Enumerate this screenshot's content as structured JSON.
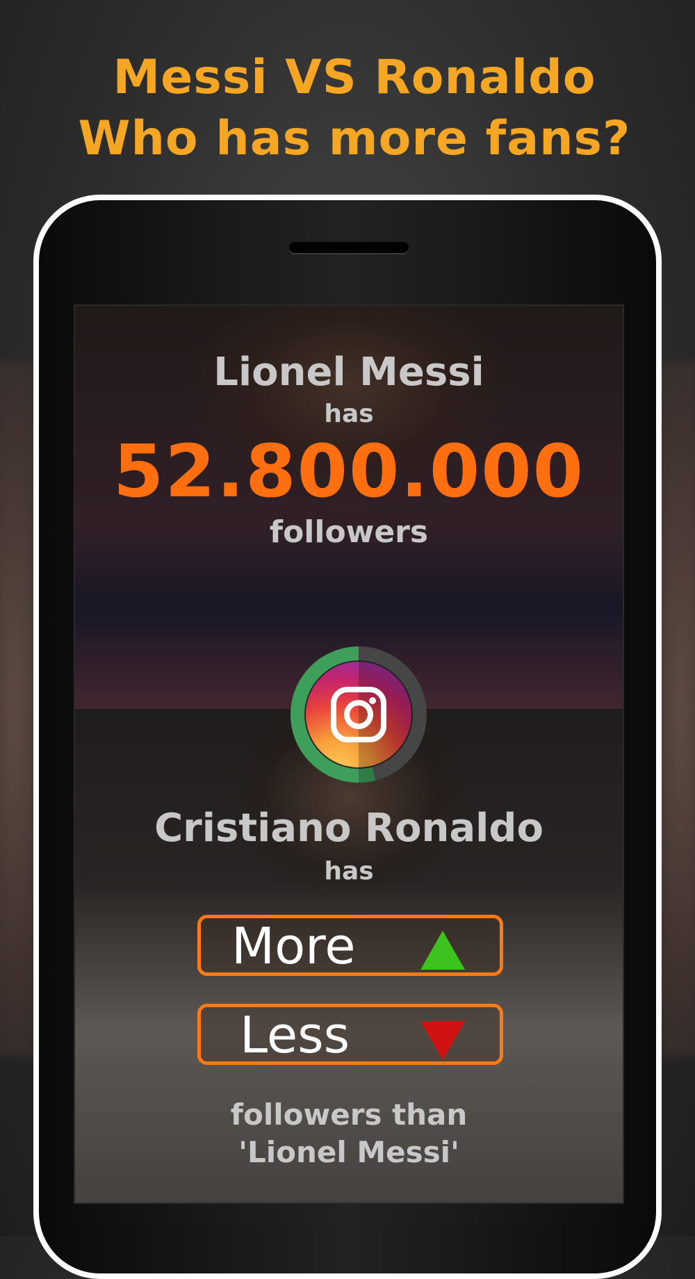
{
  "headline": {
    "line1": "Messi VS Ronaldo",
    "line2": "Who has more fans?"
  },
  "top_player": {
    "name": "Lionel Messi",
    "has": "has",
    "count": "52.800.000",
    "unit": "followers"
  },
  "bottom_player": {
    "name": "Cristiano Ronaldo",
    "has": "has",
    "comparison_line1": "followers than",
    "comparison_line2": "'Lionel Messi'"
  },
  "buttons": {
    "more_label": "More",
    "less_label": "Less"
  },
  "timer": {
    "fraction_remaining": 0.54,
    "icon": "instagram-icon"
  },
  "colors": {
    "headline": "#f5a623",
    "count": "#ff6f0f",
    "button_border": "#ff7a10",
    "more_arrow": "#3cc31e",
    "less_arrow": "#d01212",
    "timer_ring": "#3d9f5a"
  }
}
